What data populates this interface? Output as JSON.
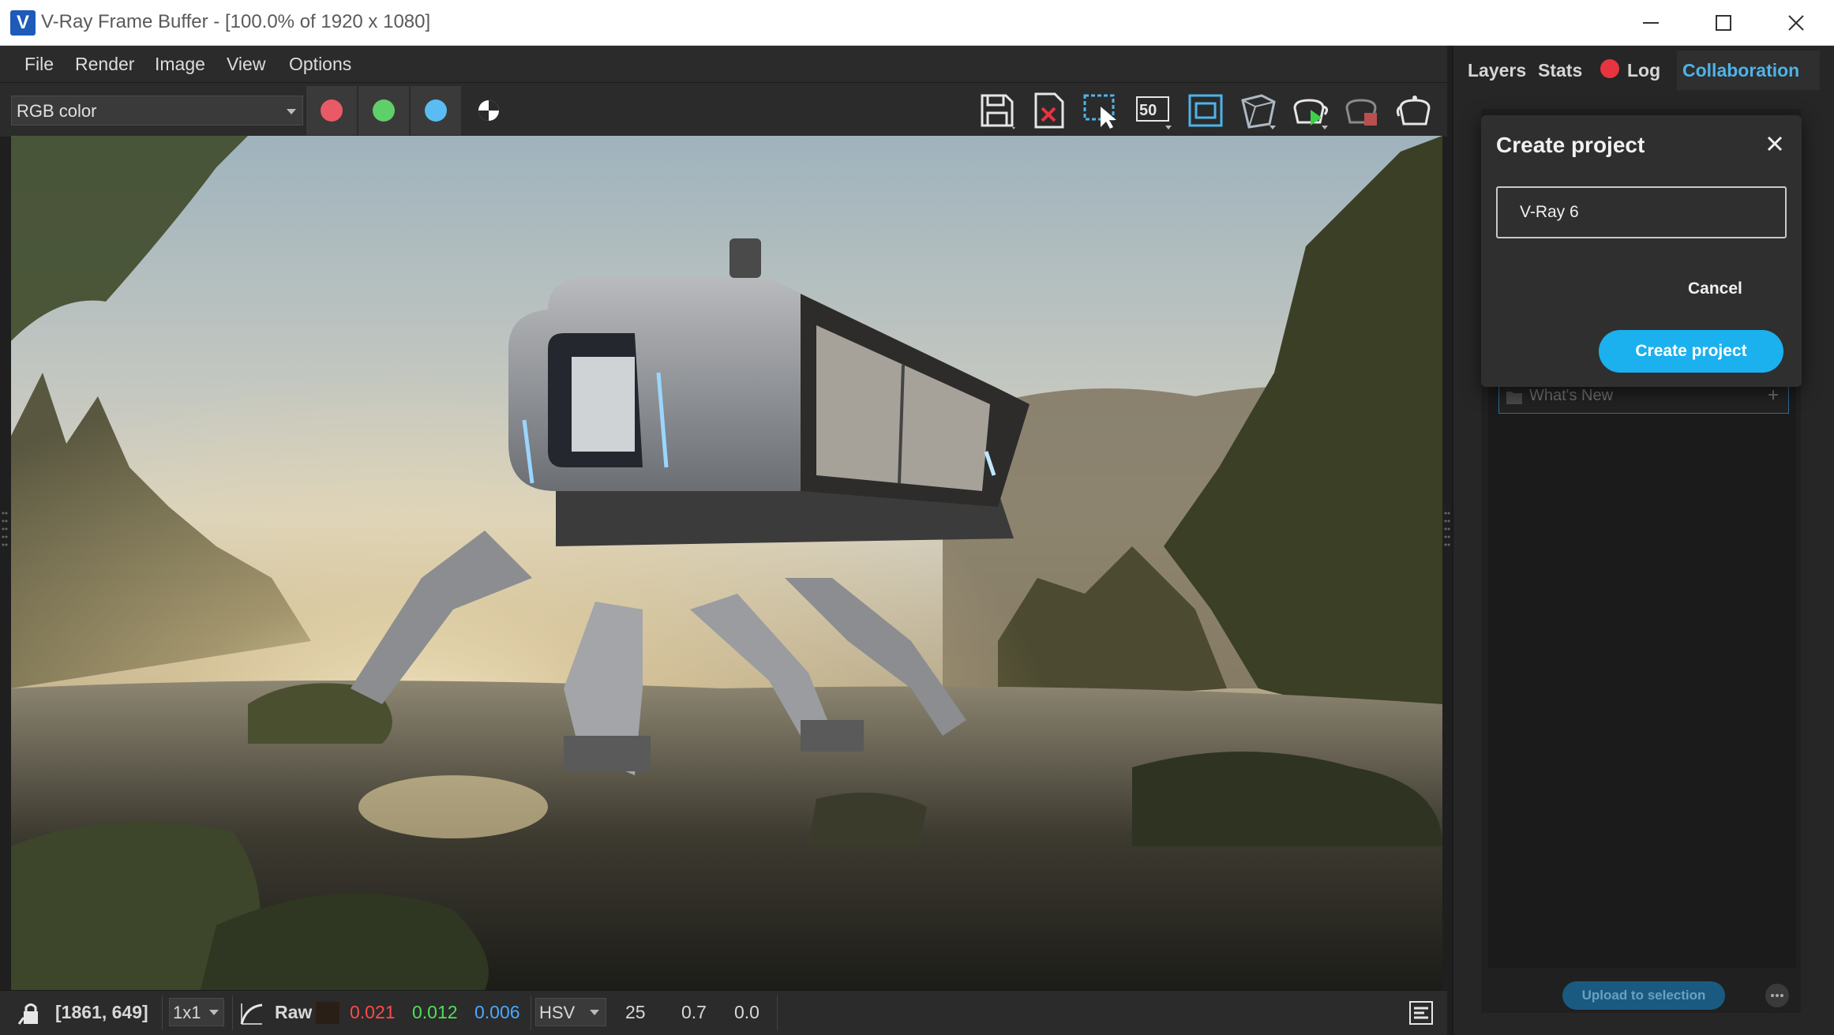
{
  "window": {
    "title": "V-Ray Frame Buffer - [100.0% of 1920 x 1080]",
    "app_icon_letter": "V",
    "controls": [
      "minimize",
      "maximize",
      "close"
    ]
  },
  "menu": {
    "items": [
      "File",
      "Render",
      "Image",
      "View",
      "Options"
    ]
  },
  "toolbar": {
    "channel": "RGB color",
    "channel_buttons": [
      {
        "name": "red-channel",
        "color": "#ea5a66"
      },
      {
        "name": "green-channel",
        "color": "#5fcf6a"
      },
      {
        "name": "blue-channel",
        "color": "#5bbcf3"
      }
    ],
    "icons": [
      "save-icon",
      "clear-image-icon",
      "region-render-icon",
      "zoom-50-icon",
      "track-mouse-icon",
      "interactive-render-icon",
      "render-icon",
      "stop-render-icon",
      "render-last-icon"
    ],
    "zoom_label": "50"
  },
  "status": {
    "coords": "[1861, 649]",
    "sample_size": "1x1",
    "mode": "Raw",
    "r": "0.021",
    "g": "0.012",
    "b": "0.006",
    "color_space": "HSV",
    "h": "25",
    "s": "0.7",
    "v": "0.0"
  },
  "panel": {
    "tabs": [
      "Layers",
      "Stats",
      "Log",
      "Collaboration"
    ],
    "active_tab": "Collaboration",
    "list_item": "What's New",
    "upload_label": "Upload to selection",
    "modal": {
      "title": "Create project",
      "input_value": "V-Ray 6",
      "cancel_label": "Cancel",
      "create_label": "Create project"
    }
  },
  "colors": {
    "accent": "#1bb0ee",
    "log_dot": "#e8343f",
    "active_tab": "#4fb3e8"
  }
}
